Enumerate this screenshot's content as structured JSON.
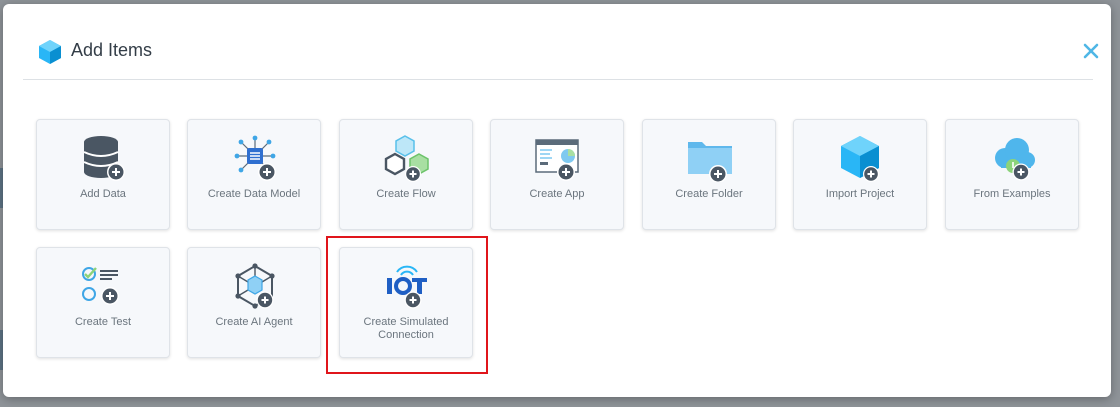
{
  "dialog": {
    "title": "Add Items",
    "header_icon": "cube-icon",
    "close_icon": "close-icon",
    "accent_color": "#29b6f6"
  },
  "tiles": [
    {
      "label": "Add Data",
      "icon": "database-add-icon"
    },
    {
      "label": "Create Data Model",
      "icon": "data-model-add-icon"
    },
    {
      "label": "Create Flow",
      "icon": "flow-add-icon"
    },
    {
      "label": "Create App",
      "icon": "app-add-icon"
    },
    {
      "label": "Create Folder",
      "icon": "folder-add-icon"
    },
    {
      "label": "Import Project",
      "icon": "import-project-icon"
    },
    {
      "label": "From Examples",
      "icon": "cloud-examples-icon"
    },
    {
      "label": "Create Test",
      "icon": "test-add-icon"
    },
    {
      "label": "Create AI Agent",
      "icon": "ai-agent-add-icon"
    },
    {
      "label": "Create Simulated Connection",
      "icon": "iot-add-icon"
    }
  ],
  "highlighted_tile": "Create Simulated Connection",
  "highlight_color": "#e0151b"
}
